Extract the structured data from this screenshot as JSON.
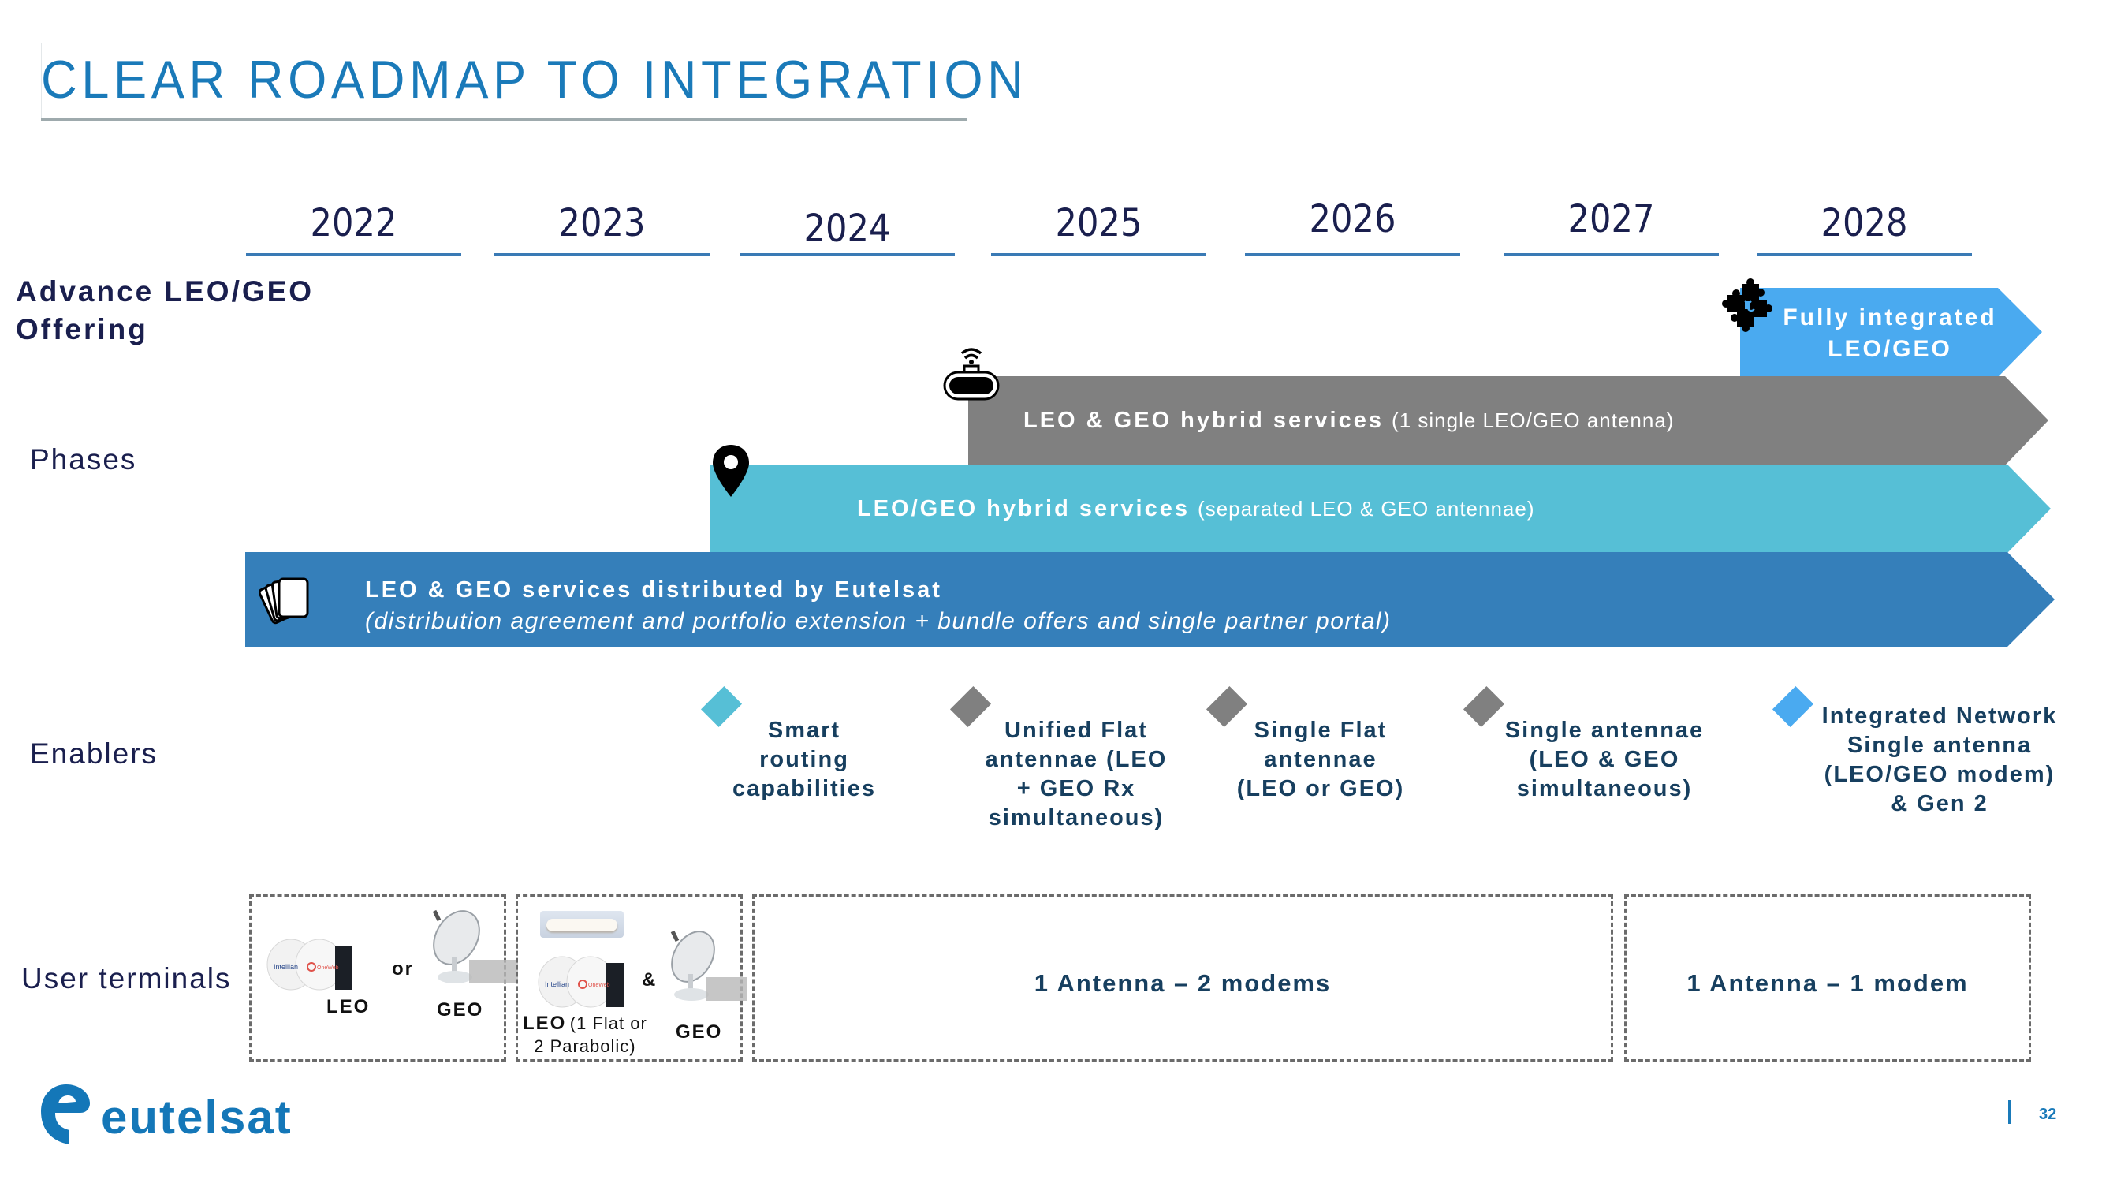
{
  "title": "CLEAR ROADMAP TO INTEGRATION",
  "years": [
    "2022",
    "2023",
    "2024",
    "2025",
    "2026",
    "2027",
    "2028"
  ],
  "row_labels": {
    "offering": [
      "Advance LEO/GEO",
      "Offering"
    ],
    "phases": "Phases",
    "enablers": "Enablers",
    "user_terminals": "User terminals"
  },
  "offering": {
    "label_line1": "Fully integrated",
    "label_line2": "LEO/GEO",
    "icon": "puzzle-icon",
    "color": "#4aaaf0"
  },
  "phases": [
    {
      "title": "LEO & GEO hybrid services",
      "subtitle": "(1 single LEO/GEO antenna)",
      "icon": "router-icon",
      "color": "#808080",
      "start_year": "2025"
    },
    {
      "title": "LEO/GEO hybrid services",
      "subtitle": "(separated LEO & GEO antennae)",
      "icon": "location-pin-icon",
      "color": "#56bfd6",
      "start_year": "2024"
    },
    {
      "title": "LEO & GEO services distributed by Eutelsat",
      "subtitle": "(distribution agreement and portfolio extension + bundle offers and single partner portal)",
      "icon": "cards-icon",
      "color": "#357fba",
      "start_year": "2022"
    }
  ],
  "enablers": [
    {
      "lines": [
        "Smart",
        "routing",
        "capabilities"
      ],
      "color": "#56bfd6"
    },
    {
      "lines": [
        "Unified Flat",
        "antennae (LEO",
        "+ GEO Rx",
        "simultaneous)"
      ],
      "color": "#808080"
    },
    {
      "lines": [
        "Single Flat",
        "antennae",
        "(LEO or GEO)"
      ],
      "color": "#808080"
    },
    {
      "lines": [
        "Single antennae",
        "(LEO & GEO",
        "simultaneous)"
      ],
      "color": "#808080"
    },
    {
      "lines": [
        "Integrated Network",
        "Single antenna",
        "(LEO/GEO modem)",
        "& Gen 2"
      ],
      "color": "#4aaaf0"
    }
  ],
  "user_terminals": {
    "box1": {
      "leo": "LEO",
      "or": "or",
      "geo": "GEO"
    },
    "box2": {
      "leo": "LEO",
      "leo_note_1": "(1 Flat or",
      "leo_note_2": "2 Parabolic)",
      "and": "&",
      "geo": "GEO",
      "dome_brand_1": "Intellian",
      "dome_brand_2": "OneWeb"
    },
    "box3": "1 Antenna – 2 modems",
    "box4": "1 Antenna – 1 modem"
  },
  "footer": {
    "logo": "eutelsat",
    "page_number": "32"
  }
}
